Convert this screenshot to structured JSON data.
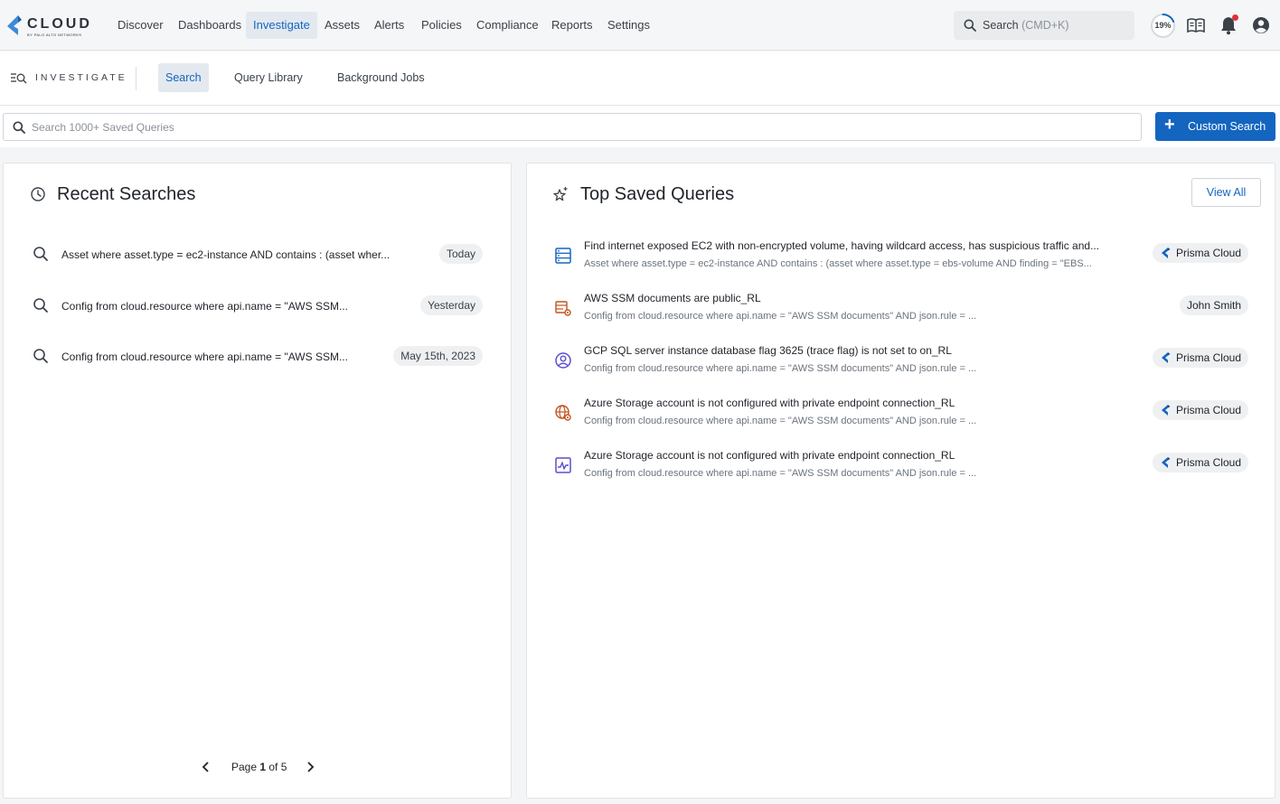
{
  "app": {
    "logo_text": "CLOUD",
    "logo_sub": "BY PALO ALTO NETWORKS"
  },
  "nav": {
    "items": [
      {
        "label": "Discover",
        "active": false
      },
      {
        "label": "Dashboards",
        "active": false
      },
      {
        "label": "Investigate",
        "active": true
      },
      {
        "label": "Assets",
        "active": false
      },
      {
        "label": "Alerts",
        "active": false
      },
      {
        "label": "Policies",
        "active": false
      },
      {
        "label": "Compliance",
        "active": false
      },
      {
        "label": "Reports",
        "active": false
      },
      {
        "label": "Settings",
        "active": false
      }
    ],
    "search_placeholder": "Search",
    "search_shortcut": "(CMD+K)",
    "progress_label": "19%",
    "progress_value": 0.19
  },
  "subnav": {
    "title": "INVESTIGATE",
    "tabs": [
      {
        "label": "Search",
        "active": true
      },
      {
        "label": "Query Library",
        "active": false
      },
      {
        "label": "Background Jobs",
        "active": false
      }
    ]
  },
  "saved_search": {
    "placeholder": "Search 1000+ Saved Queries",
    "button_label": "Custom Search"
  },
  "recent": {
    "title": "Recent Searches",
    "items": [
      {
        "query": "Asset where asset.type = ec2-instance AND contains : (asset wher...",
        "date": "Today"
      },
      {
        "query": "Config from cloud.resource where api.name = \"AWS SSM...",
        "date": "Yesterday"
      },
      {
        "query": "Config from cloud.resource where api.name = \"AWS SSM...",
        "date": "May 15th, 2023"
      }
    ],
    "pager": {
      "prefix": "Page ",
      "current": "1",
      "suffix": " of 5"
    }
  },
  "top_saved": {
    "title": "Top Saved Queries",
    "view_all_label": "View All",
    "items": [
      {
        "icon": "server-icon",
        "name": "Find internet exposed EC2 with non-encrypted volume, having wildcard access, has suspicious traffic and...",
        "query": "Asset where asset.type = ec2-instance AND contains : (asset where asset.type = ebs-volume AND finding = \"EBS...",
        "owner": "Prisma Cloud"
      },
      {
        "icon": "database-gear-icon",
        "name": "AWS SSM documents are public_RL",
        "query": "Config from cloud.resource where api.name = \"AWS SSM documents\" AND json.rule = ...",
        "owner": "John Smith"
      },
      {
        "icon": "user-circle-icon",
        "name": "GCP SQL server instance database flag 3625 (trace flag) is not set to on_RL",
        "query": "Config from cloud.resource where api.name = \"AWS SSM documents\" AND json.rule = ...",
        "owner": "Prisma Cloud"
      },
      {
        "icon": "globe-gear-icon",
        "name": "Azure Storage account is not configured with private endpoint connection_RL",
        "query": "Config from cloud.resource where api.name = \"AWS SSM documents\" AND json.rule = ...",
        "owner": "Prisma Cloud"
      },
      {
        "icon": "activity-chart-icon",
        "name": "Azure Storage account is not configured with private endpoint connection_RL",
        "query": "Config from cloud.resource where api.name = \"AWS SSM documents\" AND json.rule = ...",
        "owner": "Prisma Cloud"
      }
    ]
  },
  "colors": {
    "accent": "#1465c0",
    "notification": "#e0303a",
    "icon_orange": "#c0541c",
    "icon_blue": "#1465c0",
    "icon_purple": "#5a4fcf"
  }
}
